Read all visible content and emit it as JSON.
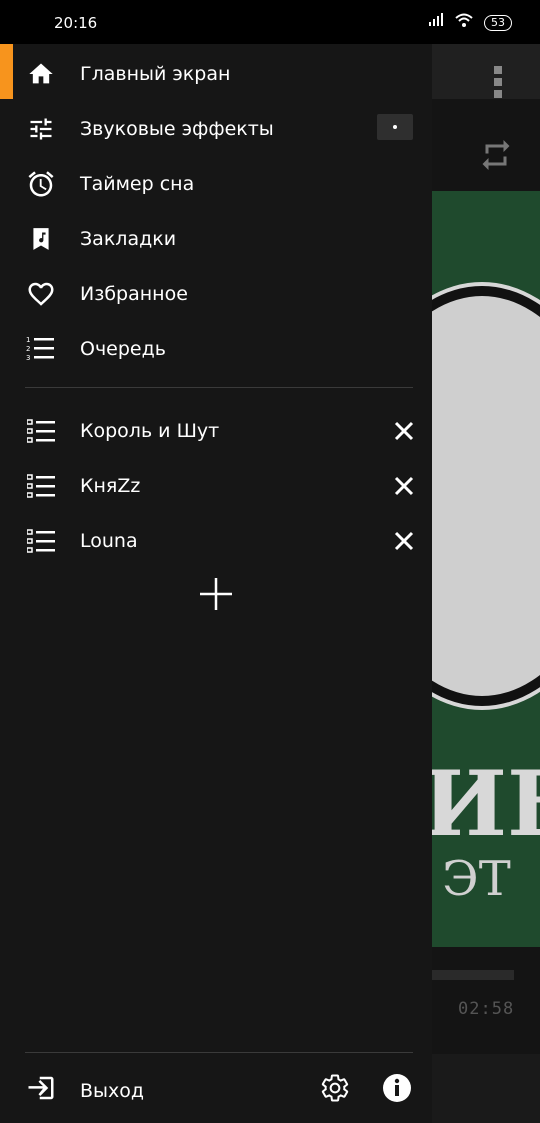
{
  "status_bar": {
    "time": "20:16",
    "battery": "53"
  },
  "drawer": {
    "menu": [
      {
        "label": "Главный экран",
        "icon": "home-icon",
        "active": true
      },
      {
        "label": "Звуковые эффекты",
        "icon": "equalizer-icon"
      },
      {
        "label": "Таймер сна",
        "icon": "alarm-icon"
      },
      {
        "label": "Закладки",
        "icon": "bookmark-music-icon"
      },
      {
        "label": "Избранное",
        "icon": "heart-icon"
      },
      {
        "label": "Очередь",
        "icon": "queue-icon"
      }
    ],
    "playlists": [
      {
        "label": "Король и Шут",
        "icon": "playlist-icon"
      },
      {
        "label": "КняZz",
        "icon": "playlist-icon"
      },
      {
        "label": "Louna",
        "icon": "playlist-icon"
      }
    ],
    "footer": {
      "exit_label": "Выход"
    }
  },
  "background": {
    "track_time": "02:58"
  },
  "colors": {
    "accent": "#f7941d",
    "drawer_bg": "#161616"
  }
}
